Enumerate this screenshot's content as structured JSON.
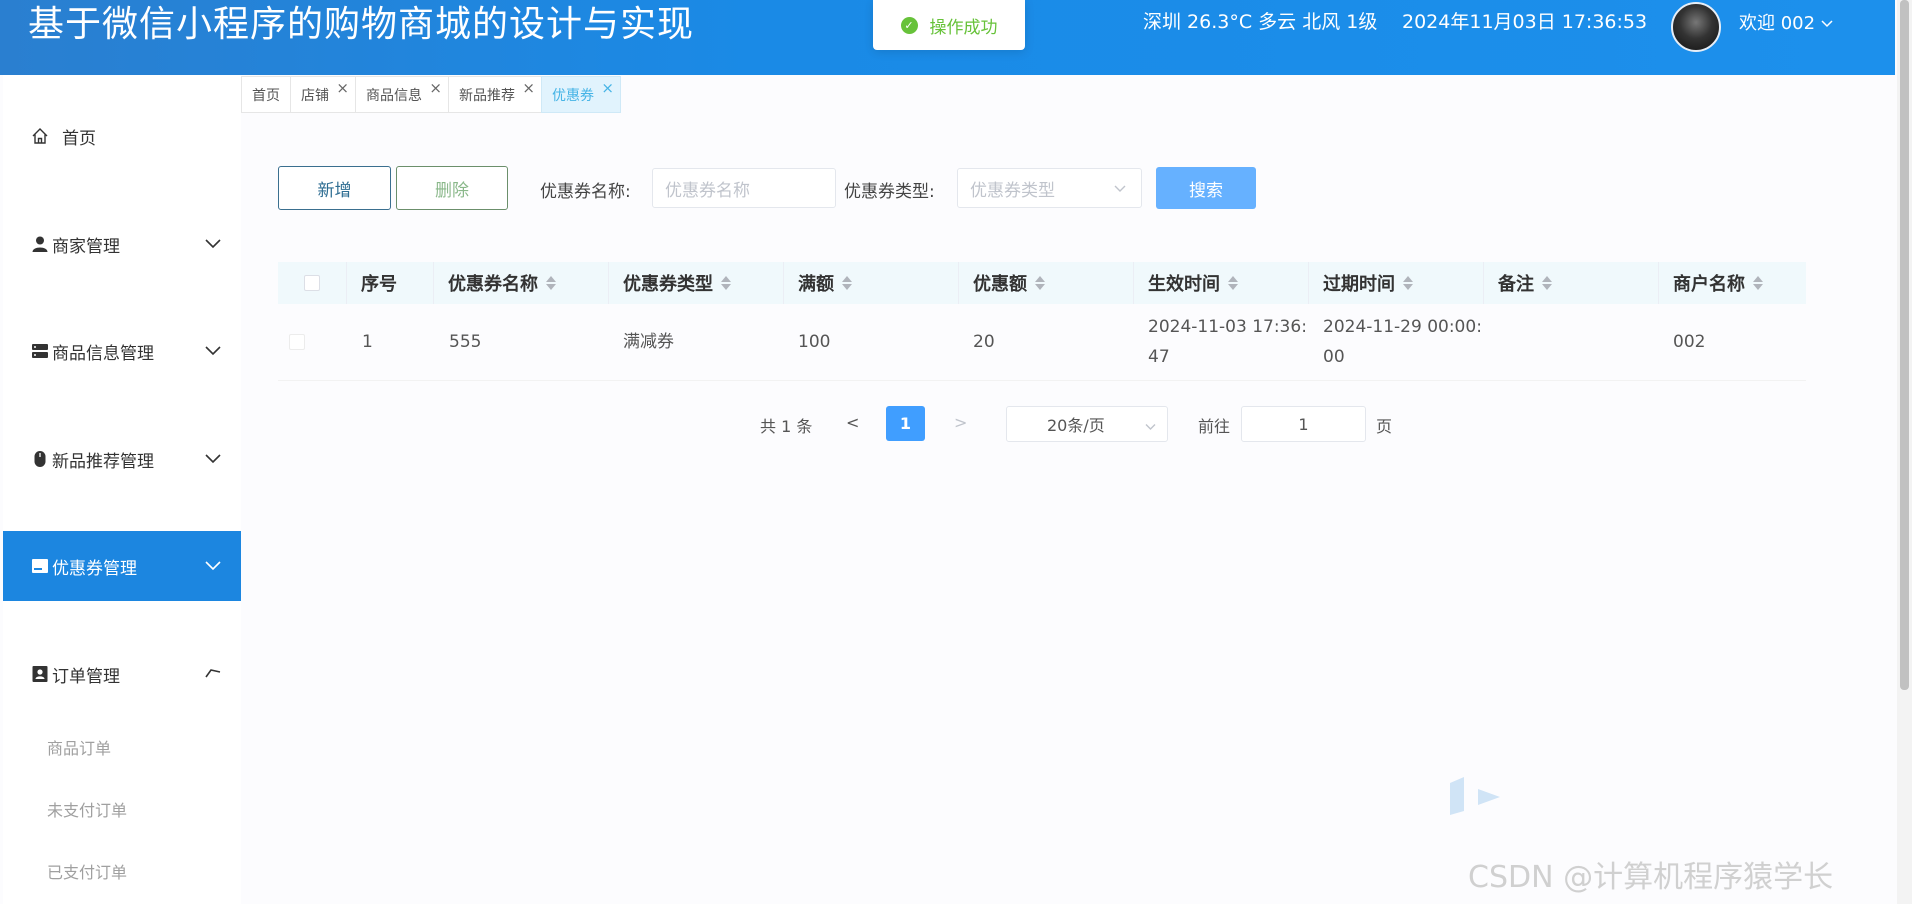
{
  "header": {
    "title": "基于微信小程序的购物商城的设计与实现",
    "weather": "深圳 26.3°C 多云 北风 1级",
    "datetime": "2024年11月03日 17:36:53",
    "welcome": "欢迎 002",
    "avatar_icon": "user-avatar"
  },
  "toast": {
    "text": "操作成功",
    "icon": "check-circle-icon",
    "color": "#67c23a"
  },
  "sidebar": {
    "items": [
      {
        "label": "首页",
        "icon": "home-icon"
      },
      {
        "label": "商家管理",
        "icon": "user-icon"
      },
      {
        "label": "商品信息管理",
        "icon": "server-icon"
      },
      {
        "label": "新品推荐管理",
        "icon": "mouse-icon"
      },
      {
        "label": "优惠券管理",
        "icon": "ticket-icon"
      },
      {
        "label": "订单管理",
        "icon": "id-card-icon"
      }
    ],
    "sub_items": [
      "商品订单",
      "未支付订单",
      "已支付订单"
    ],
    "active_color": "#1c86e0"
  },
  "tabs": [
    {
      "label": "首页"
    },
    {
      "label": "店铺"
    },
    {
      "label": "商品信息"
    },
    {
      "label": "新品推荐"
    },
    {
      "label": "优惠券"
    }
  ],
  "toolbar": {
    "add_label": "新增",
    "delete_label": "删除",
    "name_label": "优惠券名称:",
    "name_placeholder": "优惠券名称",
    "type_label": "优惠券类型:",
    "type_placeholder": "优惠券类型",
    "search_label": "搜索"
  },
  "table": {
    "columns": [
      "序号",
      "优惠券名称",
      "优惠券类型",
      "满额",
      "优惠额",
      "生效时间",
      "过期时间",
      "备注",
      "商户名称"
    ],
    "rows": [
      {
        "index": "1",
        "name": "555",
        "type": "满减券",
        "threshold": "100",
        "discount": "20",
        "start_l1": "2024-11-03 17:36:",
        "start_l2": "47",
        "end_l1": "2024-11-29 00:00:",
        "end_l2": "00",
        "remark": "",
        "merchant": "002"
      }
    ]
  },
  "pagination": {
    "total": "共 1 条",
    "prev": "<",
    "current": "1",
    "next": ">",
    "page_size": "20条/页",
    "goto_label": "前往",
    "goto_value": "1",
    "page_suffix": "页"
  },
  "watermark": "CSDN @计算机程序猿学长"
}
